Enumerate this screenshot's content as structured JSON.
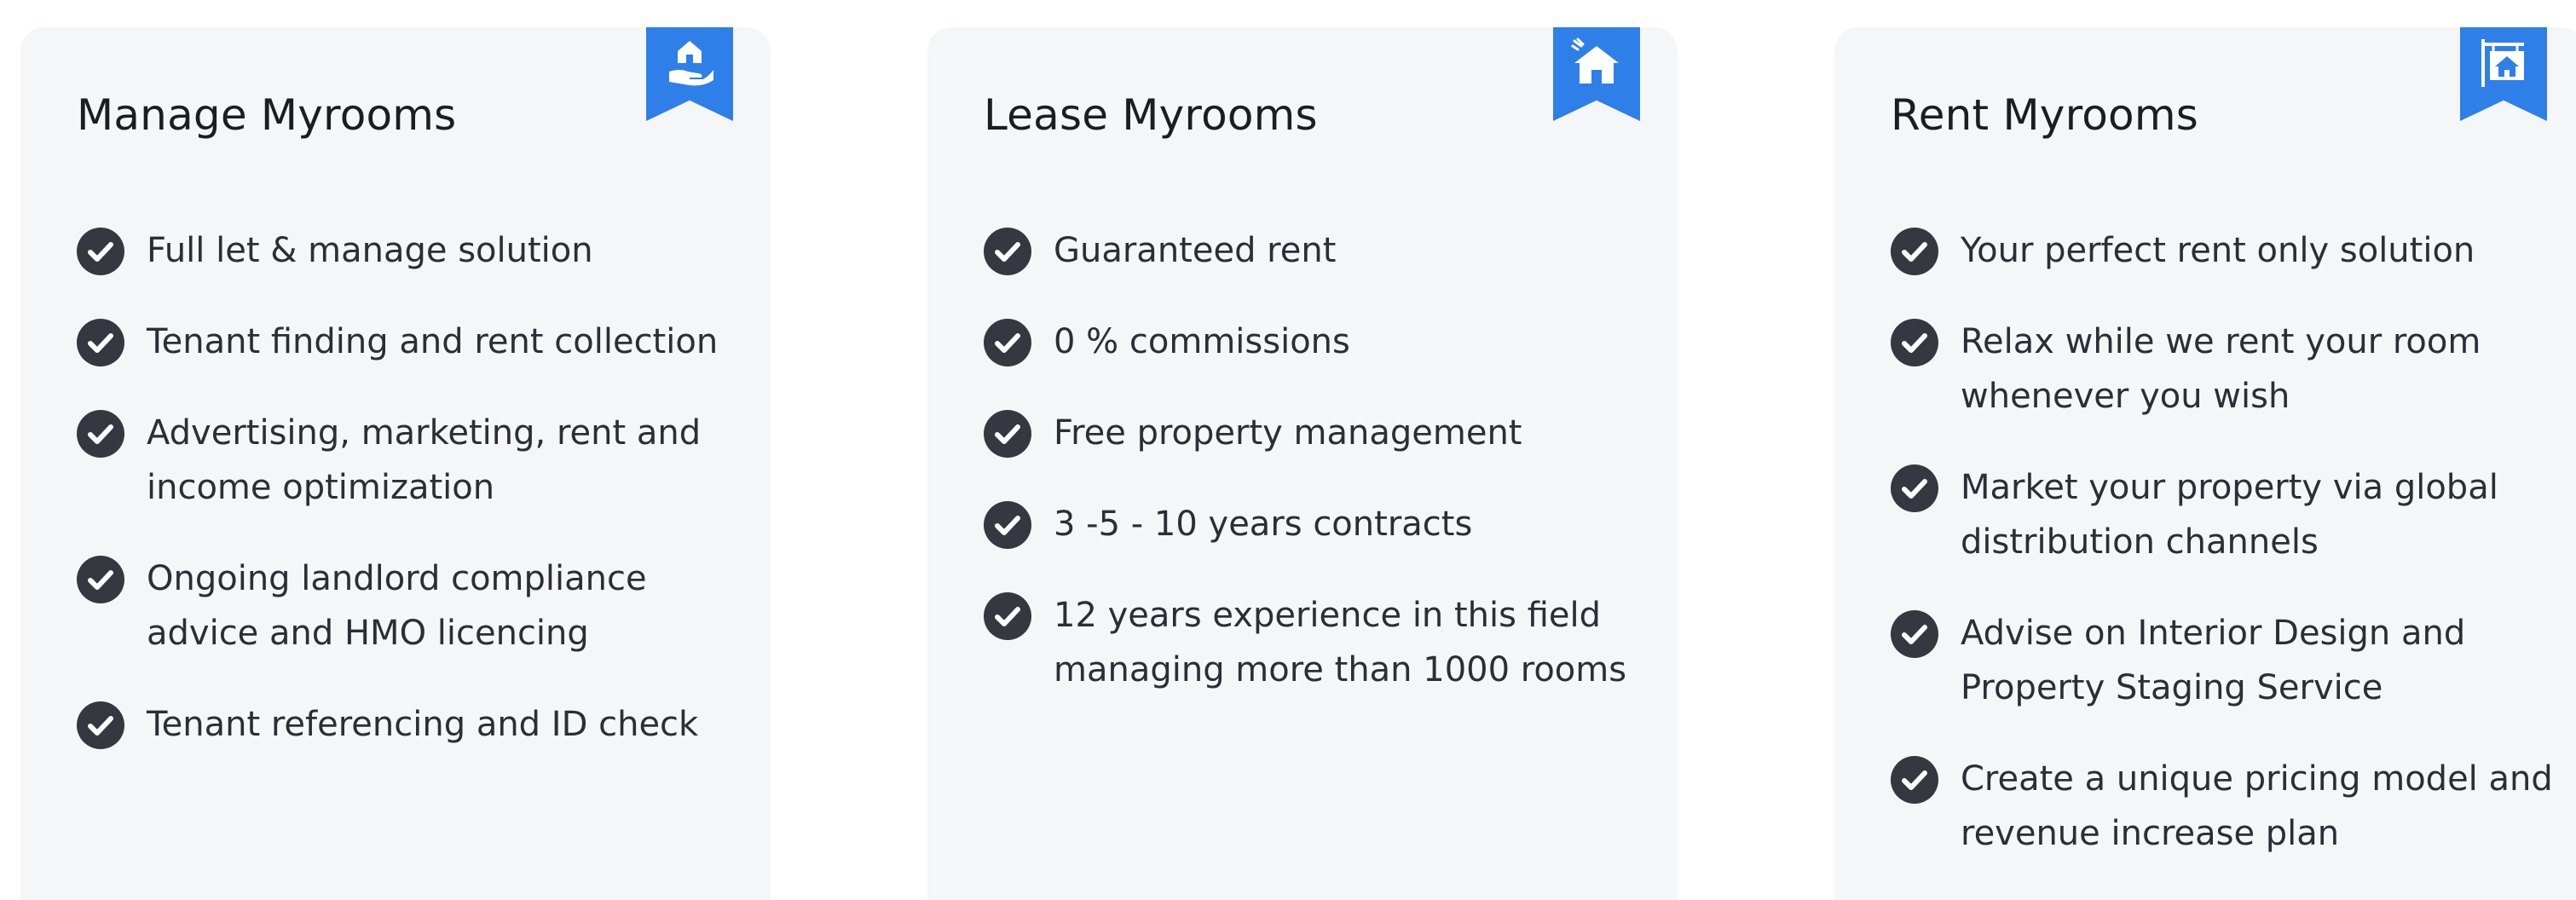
{
  "colors": {
    "card_background": "#f4f6f8",
    "ribbon": "#2f7fe9",
    "check_circle": "#353741",
    "title_text": "#1b1d22",
    "body_text": "#2b2e36"
  },
  "cards": [
    {
      "title": "Manage Myrooms",
      "icon": "hand-house-icon",
      "features": [
        "Full let & manage solution",
        "Tenant finding and rent collection",
        "Advertising, marketing, rent and income optimization",
        "Ongoing landlord compliance advice and HMO licencing",
        "Tenant referencing and ID check"
      ]
    },
    {
      "title": "Lease Myrooms",
      "icon": "house-icon",
      "features": [
        "Guaranteed rent",
        "0 % commissions",
        "Free property management",
        "3 -5 - 10 years contracts",
        "12 years experience in this field managing more than 1000 rooms"
      ]
    },
    {
      "title": "Rent Myrooms",
      "icon": "house-sign-icon",
      "features": [
        "Your perfect rent only solution",
        "Relax while we rent your room whenever you wish",
        "Market your property via global distribution channels",
        "Advise on Interior Design and Property Staging Service",
        "Create a unique pricing model and revenue increase plan"
      ]
    }
  ]
}
